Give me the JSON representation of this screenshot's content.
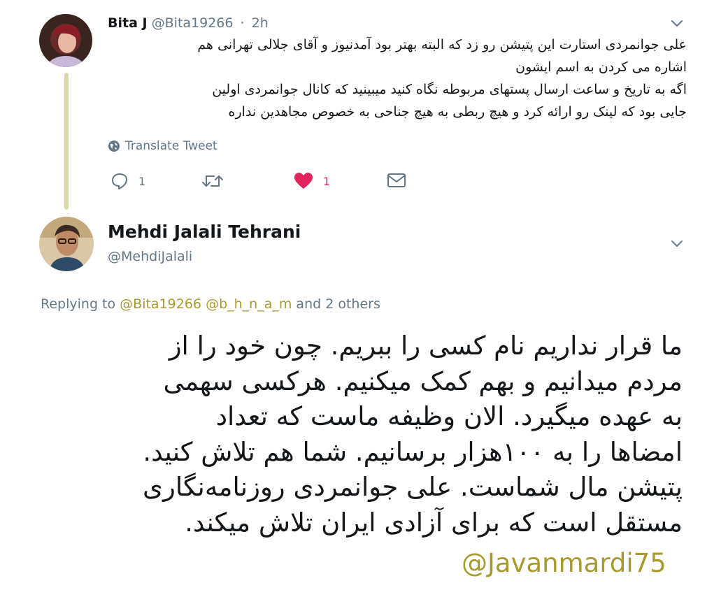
{
  "parent_tweet": {
    "name": "Bita J",
    "handle": "@Bita19266",
    "dot": "·",
    "time": "2h",
    "text_lines": [
      "علی جوانمردی استارت این پتیشن رو زد که البته بهتر بود آمدنیوز و آقای جلالی تهرانی هم",
      "اشاره می کردن به اسم ایشون",
      "اگه به تاریخ و ساعت ارسال پستهای مربوطه نگاه کنید میبینید که کانال جوانمردی اولین",
      "جایی بود که لینک رو ارائه کرد و هیچ ربطی به هیچ جناحی به خصوص مجاهدین نداره"
    ],
    "translate_label": "Translate Tweet",
    "reply_count": "1",
    "like_count": "1",
    "avatar_icon": "user-avatar-icon",
    "like_color": "#e0245e"
  },
  "main_tweet": {
    "name": "Mehdi Jalali Tehrani",
    "handle": "@MehdiJalali",
    "replying_prefix": "Replying to",
    "replying_mention_1": "@Bita19266",
    "replying_mention_2": "@b_h_n_a_m",
    "replying_suffix": "and 2 others",
    "text_lines": [
      "ما قرار نداریم نام کسی را ببریم. چون خود را از",
      "مردم میدانیم و بهم کمک میکنیم. هرکسی سهمی",
      "به عهده میگیرد. الان وظیفه ماست که تعداد",
      "امضاها را به ۱۰۰هزار برسانیم. شما هم تلاش کنید.",
      "پتیشن مال شماست. علی جوانمردی روزنامه‌نگاری",
      "مستقل است که برای آزادی ایران تلاش میکند."
    ],
    "mention": "@Javanmardi75",
    "mention_color": "#a89a2c"
  },
  "colors": {
    "text": "#14171a",
    "secondary": "#657786",
    "thread_line": "#dcd7a6"
  }
}
